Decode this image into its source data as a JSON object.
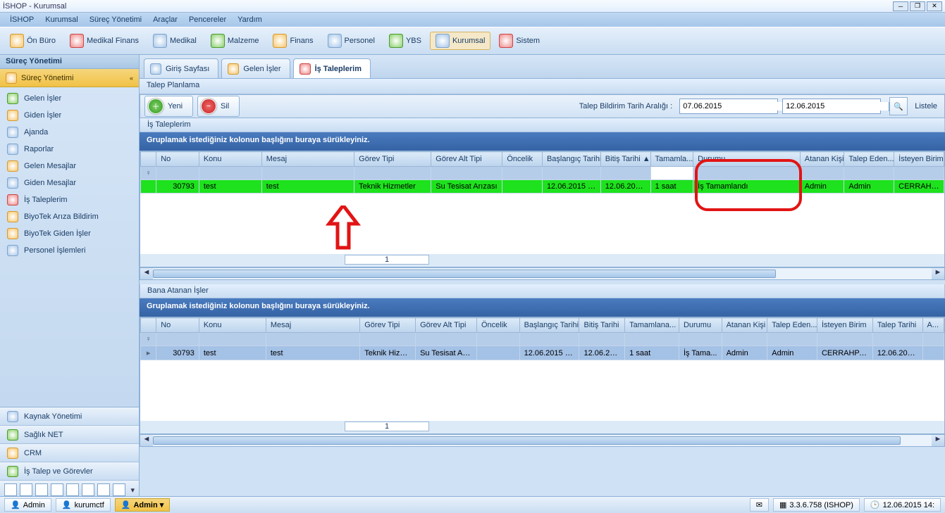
{
  "window": {
    "title": "İSHOP - Kurumsal"
  },
  "menu": [
    "İSHOP",
    "Kurumsal",
    "Süreç Yönetimi",
    "Araçlar",
    "Pencereler",
    "Yardım"
  ],
  "toolbar": {
    "items": [
      {
        "label": "Ön Büro"
      },
      {
        "label": "Medikal Finans"
      },
      {
        "label": "Medikal"
      },
      {
        "label": "Malzeme"
      },
      {
        "label": "Finans"
      },
      {
        "label": "Personel"
      },
      {
        "label": "YBS"
      },
      {
        "label": "Kurumsal",
        "active": true
      },
      {
        "label": "Sistem"
      }
    ]
  },
  "sidebar": {
    "title": "Süreç Yönetimi",
    "navheader": "Süreç Yönetimi",
    "items": [
      "Gelen İşler",
      "Giden İşler",
      "Ajanda",
      "Raporlar",
      "Gelen Mesajlar",
      "Giden Mesajlar",
      "İş Taleplerim",
      "BiyoTek Arıza Bildirim",
      "BiyoTek Giden İşler",
      "Personel İşlemleri"
    ],
    "bottom": [
      "Kaynak Yönetimi",
      "Sağlık NET",
      "CRM",
      "İş Talep ve Görevler"
    ]
  },
  "tabs": [
    {
      "label": "Giriş Sayfası"
    },
    {
      "label": "Gelen İşler"
    },
    {
      "label": "İş Taleplerim",
      "active": true
    }
  ],
  "subheader": "Talep Planlama",
  "actions": {
    "new_label": "Yeni",
    "delete_label": "Sil"
  },
  "daterange": {
    "label": "Talep Bildirim Tarih Aralığı :",
    "from": "07.06.2015",
    "to": "12.06.2015",
    "list_label": "Listele"
  },
  "grid1": {
    "title": "İş Taleplerim",
    "group_hint": "Gruplamak istediğiniz kolonun başlığını buraya sürükleyiniz.",
    "columns": [
      "No",
      "Konu",
      "Mesaj",
      "Görev Tipi",
      "Görev Alt Tipi",
      "Öncelik",
      "Başlangıç Tarihi",
      "Bitiş Tarihi ▲",
      "Tamamla...",
      "Durumu",
      "Atanan Kişi",
      "Talep Eden...",
      "İsteyen Birim"
    ],
    "rows": [
      {
        "no": "30793",
        "konu": "test",
        "mesaj": "test",
        "gorev_tipi": "Teknik Hizmetler",
        "gorev_alt": "Su Tesisat Arızası",
        "oncelik": "",
        "baslangic": "12.06.2015 1...",
        "bitis": "12.06.201...",
        "tamam": "1 saat",
        "durum": "İş Tamamlandı",
        "atanan": "Admin",
        "talep_eden": "Admin",
        "birim": "CERRAHPA..."
      }
    ],
    "page": "1"
  },
  "grid2": {
    "title": "Bana Atanan İşler",
    "group_hint": "Gruplamak istediğiniz kolonun başlığını buraya sürükleyiniz.",
    "columns": [
      "No",
      "Konu",
      "Mesaj",
      "Görev Tipi",
      "Görev Alt Tipi",
      "Öncelik",
      "Başlangıç Tarihi",
      "Bitiş Tarihi",
      "Tamamlana...",
      "Durumu",
      "Atanan Kişi",
      "Talep Eden...",
      "İsteyen Birim",
      "Talep Tarihi",
      "A..."
    ],
    "rows": [
      {
        "no": "30793",
        "konu": "test",
        "mesaj": "test",
        "gorev_tipi": "Teknik Hizm...",
        "gorev_alt": "Su Tesisat Arı...",
        "oncelik": "",
        "baslangic": "12.06.2015 1...",
        "bitis": "12.06.20...",
        "tamam": "1 saat",
        "durum": "İş Tama...",
        "atanan": "Admin",
        "talep_eden": "Admin",
        "birim": "CERRAHPA...",
        "talep_tarih": "12.06.201...",
        "a": ""
      }
    ],
    "page": "1"
  },
  "status": {
    "user1": "Admin",
    "user2": "kurumctf",
    "user3": "Admin ▾",
    "version": "3.3.6.758 (ISHOP)",
    "datetime": "12.06.2015 14:"
  }
}
